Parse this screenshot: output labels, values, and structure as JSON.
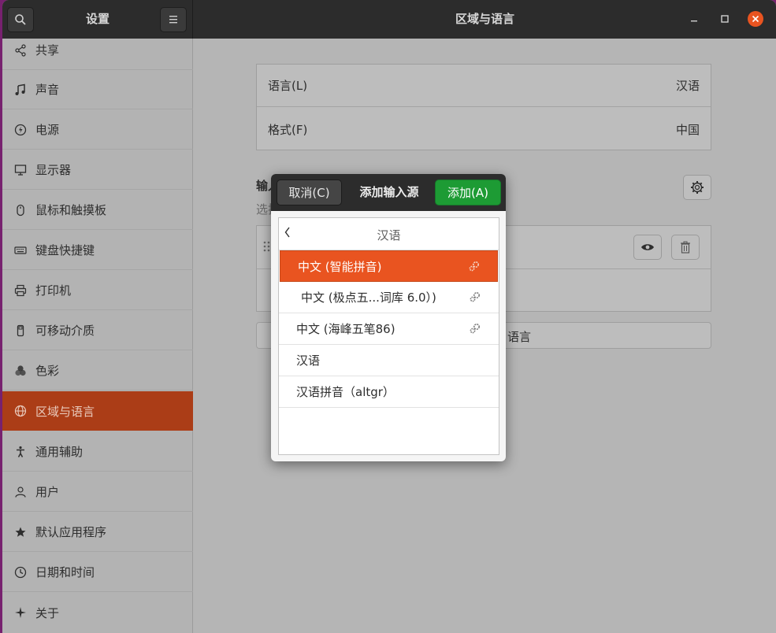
{
  "window": {
    "sidebar_title": "设置",
    "title": "区域与语言"
  },
  "sidebar": {
    "items": [
      {
        "label": "共享",
        "icon": "share-icon"
      },
      {
        "label": "声音",
        "icon": "music-note-icon"
      },
      {
        "label": "电源",
        "icon": "power-icon"
      },
      {
        "label": "显示器",
        "icon": "display-icon"
      },
      {
        "label": "鼠标和触摸板",
        "icon": "mouse-icon"
      },
      {
        "label": "键盘快捷键",
        "icon": "keyboard-icon"
      },
      {
        "label": "打印机",
        "icon": "printer-icon"
      },
      {
        "label": "可移动介质",
        "icon": "removable-media-icon"
      },
      {
        "label": "色彩",
        "icon": "color-icon"
      },
      {
        "label": "区域与语言",
        "icon": "globe-icon",
        "active": true
      },
      {
        "label": "通用辅助",
        "icon": "accessibility-icon"
      },
      {
        "label": "用户",
        "icon": "user-icon"
      },
      {
        "label": "默认应用程序",
        "icon": "star-icon"
      },
      {
        "label": "日期和时间",
        "icon": "clock-icon"
      },
      {
        "label": "关于",
        "icon": "sparkle-icon"
      }
    ]
  },
  "main": {
    "language_label": "语言(L)",
    "language_value": "汉语",
    "format_label": "格式(F)",
    "format_value": "中国",
    "input_sources_title_partial": "输入",
    "input_sources_sub_partial": "选择",
    "add_language_partial": "语言"
  },
  "dialog": {
    "cancel_label": "取消(C)",
    "title": "添加输入源",
    "add_label": "添加(A)",
    "list_header": "汉语",
    "items": [
      {
        "label": "中文 (智能拼音)",
        "has_settings": true,
        "selected": true
      },
      {
        "label": "中文 (极点五...词库 6.0）)",
        "has_settings": true
      },
      {
        "label": "中文 (海峰五笔86)",
        "has_settings": true
      },
      {
        "label": "汉语",
        "has_settings": false
      },
      {
        "label": "汉语拼音（altgr）",
        "has_settings": false
      }
    ]
  },
  "colors": {
    "accent": "#e95420",
    "sidebar_active": "#ab3d17",
    "add_button": "#1d9b34",
    "close_button": "#e95420"
  }
}
